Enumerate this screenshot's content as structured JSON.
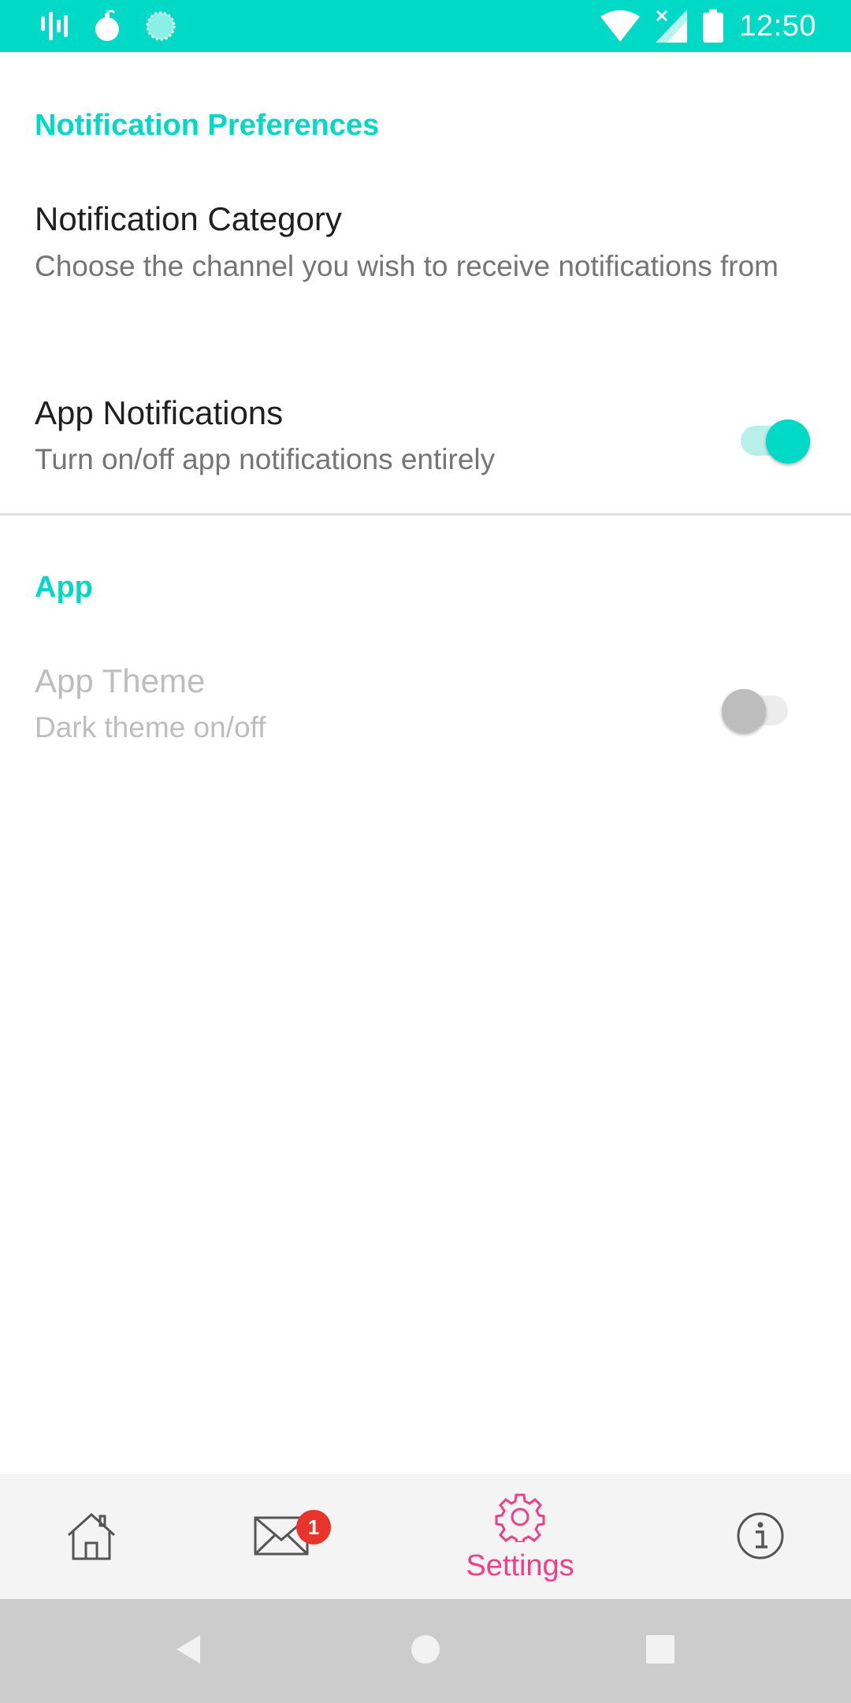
{
  "status_bar": {
    "time": "12:50",
    "left_icons": [
      "signal-bars-icon",
      "bomb-icon",
      "loading-circle-icon"
    ],
    "right_icons": [
      "wifi-icon",
      "no-signal-icon",
      "battery-icon"
    ],
    "color": "#00d9c5"
  },
  "sections": {
    "notifications": {
      "header": "Notification Preferences",
      "category": {
        "title": "Notification Category",
        "summary": "Choose the channel you wish to receive notifications from"
      },
      "app_notifications": {
        "title": "App Notifications",
        "summary": "Turn on/off app notifications entirely",
        "enabled": true
      }
    },
    "app": {
      "header": "App",
      "theme": {
        "title": "App Theme",
        "summary": "Dark theme on/off",
        "enabled": false,
        "disabled": true
      }
    }
  },
  "bottom_nav": {
    "items": [
      {
        "icon": "home-icon",
        "label": ""
      },
      {
        "icon": "mail-icon",
        "label": "",
        "badge": "1"
      },
      {
        "icon": "gear-icon",
        "label": "Settings",
        "active": true
      },
      {
        "icon": "info-icon",
        "label": ""
      }
    ],
    "accent": "#ef3f86"
  },
  "system_nav": {
    "buttons": [
      "back-icon",
      "home-circle-icon",
      "recents-icon"
    ]
  }
}
